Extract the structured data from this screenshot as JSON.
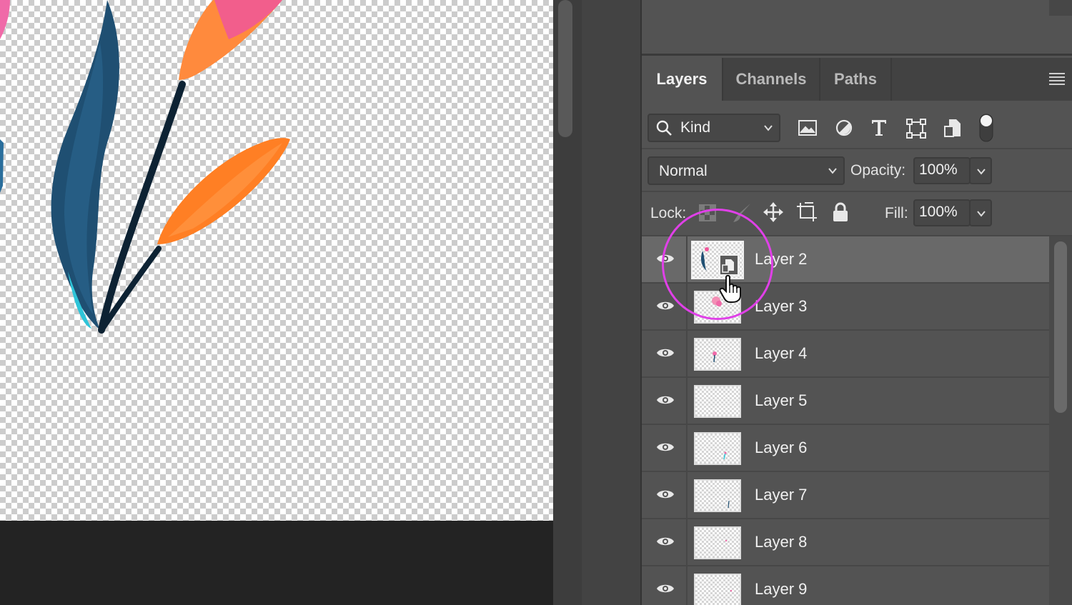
{
  "panel": {
    "tabs": [
      {
        "label": "Layers",
        "active": true
      },
      {
        "label": "Channels",
        "active": false
      },
      {
        "label": "Paths",
        "active": false
      }
    ],
    "filter": {
      "kind_label": "Kind"
    },
    "blend_mode": "Normal",
    "opacity": {
      "label": "Opacity:",
      "value": "100%"
    },
    "lock": {
      "label": "Lock:"
    },
    "fill": {
      "label": "Fill:",
      "value": "100%"
    },
    "layers": [
      {
        "name": "Layer 2",
        "selected": true,
        "visible": true,
        "smart_object": true
      },
      {
        "name": "Layer 3",
        "selected": false,
        "visible": true
      },
      {
        "name": "Layer 4",
        "selected": false,
        "visible": true
      },
      {
        "name": "Layer 5",
        "selected": false,
        "visible": true
      },
      {
        "name": "Layer 6",
        "selected": false,
        "visible": true
      },
      {
        "name": "Layer 7",
        "selected": false,
        "visible": true
      },
      {
        "name": "Layer 8",
        "selected": false,
        "visible": true
      },
      {
        "name": "Layer 9",
        "selected": false,
        "visible": true
      }
    ]
  },
  "colors": {
    "highlight_circle": "#e040e8",
    "leaf_blue": "#1f4f72",
    "leaf_orange": "#ff7f24",
    "leaf_pink": "#f0569a",
    "stem_dark": "#0d2233"
  },
  "icons": [
    "search-icon",
    "image-filter-icon",
    "adjustment-filter-icon",
    "type-filter-icon",
    "shape-filter-icon",
    "smart-object-filter-icon",
    "filter-toggle-icon",
    "lock-transparent-icon",
    "lock-image-icon",
    "lock-position-icon",
    "lock-artboard-icon",
    "lock-all-icon",
    "eye-icon",
    "hand-cursor-icon",
    "panel-menu-icon"
  ]
}
